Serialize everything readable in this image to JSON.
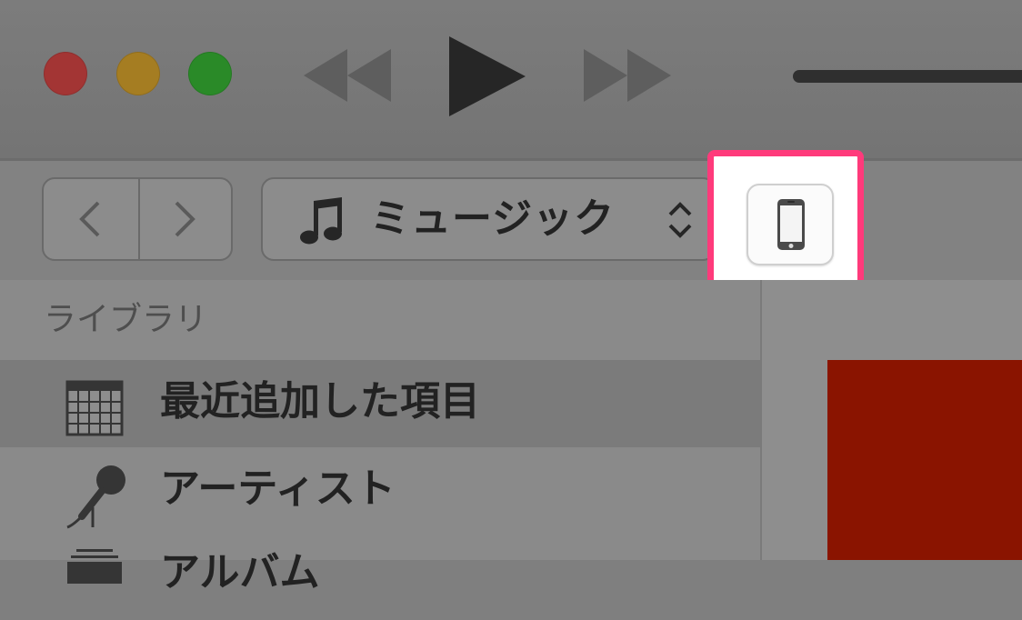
{
  "window": {
    "controls": [
      {
        "name": "close-button",
        "color": "#a33534"
      },
      {
        "name": "minimize-button",
        "color": "#a57d22"
      },
      {
        "name": "zoom-button",
        "color": "#2a8a28"
      }
    ]
  },
  "transport": {
    "icons": [
      "rewind-icon",
      "play-icon",
      "fast-forward-icon"
    ]
  },
  "toolbar": {
    "media_selector": {
      "icon": "music-note-icon",
      "label": "ミュージック",
      "arrow_icon": "up-down-chevron-icon"
    },
    "device_button": {
      "icon": "iphone-icon"
    },
    "highlight_color": "#ff3a7b"
  },
  "sidebar": {
    "heading": "ライブラリ",
    "items": [
      {
        "label": "最近追加した項目",
        "icon": "calendar-grid-icon",
        "selected": true
      },
      {
        "label": "アーティスト",
        "icon": "microphone-icon",
        "selected": false
      },
      {
        "label": "アルバム",
        "icon": "album-icon",
        "selected": false
      }
    ]
  },
  "content": {
    "album_color": "#8a1400"
  }
}
